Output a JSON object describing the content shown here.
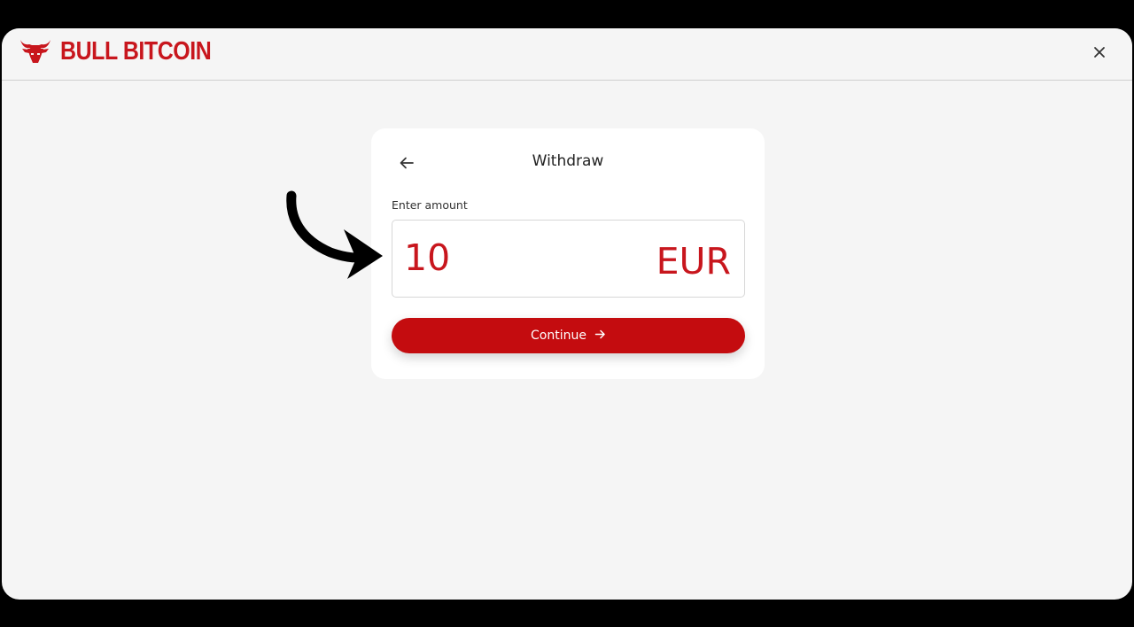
{
  "brand": {
    "name": "BULL BITCOIN",
    "logo_icon": "bull-head-icon",
    "color": "#c8161d"
  },
  "window": {
    "close_icon": "close-icon"
  },
  "withdraw": {
    "title": "Withdraw",
    "back_icon": "arrow-left-icon",
    "amount_label": "Enter amount",
    "amount_value": "10",
    "currency": "EUR",
    "continue_label": "Continue",
    "continue_icon": "arrow-right-icon",
    "accent_color": "#c40c0f"
  },
  "annotation": {
    "icon": "curved-pointer-arrow-icon",
    "color": "#000000"
  }
}
